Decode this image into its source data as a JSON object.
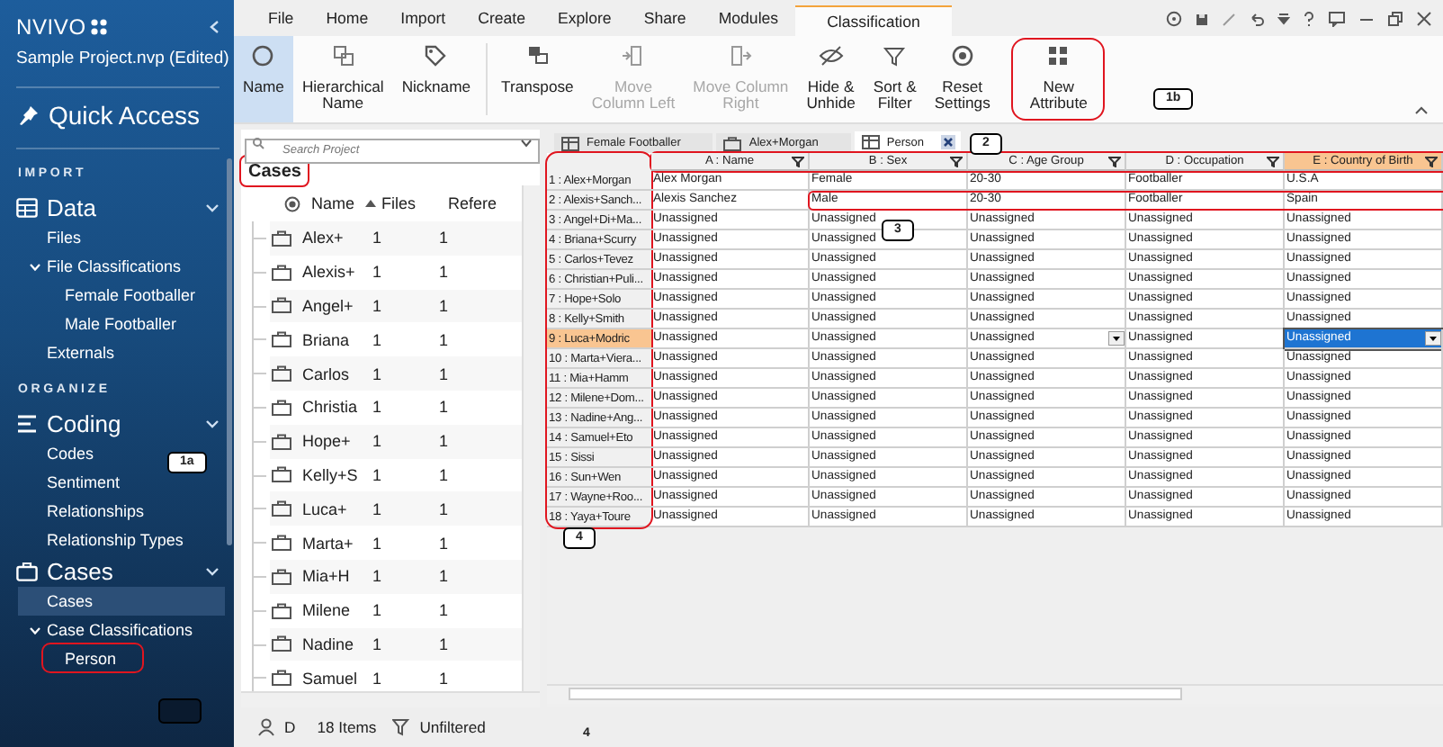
{
  "sidebar": {
    "logo": "NVIVO",
    "project": "Sample Project.nvp (Edited)",
    "quick_access": "Quick Access",
    "sections": [
      {
        "heading": "IMPORT",
        "groups": [
          {
            "title": "Data",
            "expanded": true,
            "items": [
              {
                "label": "Files",
                "selected": false
              },
              {
                "label": "File Classifications",
                "selected": false,
                "expanded": true,
                "children": [
                  {
                    "label": "Female Footballer",
                    "selected": false,
                    "circled": false
                  },
                  {
                    "label": "Male Footballer",
                    "selected": false,
                    "circled": false
                  }
                ]
              },
              {
                "label": "Externals",
                "selected": false
              }
            ]
          }
        ]
      },
      {
        "heading": "ORGANIZE",
        "groups": [
          {
            "title": "Coding",
            "expanded": true,
            "items": [
              {
                "label": "Codes",
                "selected": false
              },
              {
                "label": "Sentiment",
                "selected": false
              },
              {
                "label": "Relationships",
                "selected": false
              },
              {
                "label": "Relationship Types",
                "selected": false
              }
            ]
          },
          {
            "title": "Cases",
            "expanded": true,
            "items": [
              {
                "label": "Cases",
                "selected": true
              },
              {
                "label": "Case Classifications",
                "selected": false,
                "expanded": true,
                "children": [
                  {
                    "label": "Person",
                    "selected": false,
                    "circled": true
                  }
                ]
              }
            ]
          }
        ]
      }
    ]
  },
  "menu": {
    "tabs": [
      {
        "label": "File",
        "selected": false
      },
      {
        "label": "Home",
        "selected": false
      },
      {
        "label": "Import",
        "selected": false
      },
      {
        "label": "Create",
        "selected": false
      },
      {
        "label": "Explore",
        "selected": false
      },
      {
        "label": "Share",
        "selected": false
      },
      {
        "label": "Modules",
        "selected": false
      },
      {
        "label": "Classification",
        "selected": true
      }
    ]
  },
  "ribbon": {
    "buttons": [
      {
        "label": "Name",
        "selected": true,
        "disabled": false,
        "circled": false
      },
      {
        "label": "Hierarchical\nName",
        "selected": false,
        "disabled": false,
        "circled": false
      },
      {
        "label": "Nickname",
        "selected": false,
        "disabled": false,
        "circled": false
      },
      {
        "label": "Transpose",
        "selected": false,
        "disabled": false,
        "circled": false
      },
      {
        "label": "Move\nColumn Left",
        "selected": false,
        "disabled": true,
        "circled": false
      },
      {
        "label": "Move Column\nRight",
        "selected": false,
        "disabled": true,
        "circled": false
      },
      {
        "label": "Hide &\nUnhide",
        "selected": false,
        "disabled": false,
        "circled": false
      },
      {
        "label": "Sort &\nFilter",
        "selected": false,
        "disabled": false,
        "circled": false
      },
      {
        "label": "Reset\nSettings",
        "selected": false,
        "disabled": false,
        "circled": false
      },
      {
        "label": "New\nAttribute",
        "selected": false,
        "disabled": false,
        "circled": true
      }
    ]
  },
  "cases_pane": {
    "search": {
      "placeholder": "Search Project"
    },
    "heading": "Cases",
    "heading_circled": true,
    "columns": [
      "Name",
      "Files",
      "Refere"
    ],
    "rows": [
      {
        "name": "Alex+",
        "files": "1",
        "refs": "1"
      },
      {
        "name": "Alexis+",
        "files": "1",
        "refs": "1"
      },
      {
        "name": "Angel+",
        "files": "1",
        "refs": "1"
      },
      {
        "name": "Briana",
        "files": "1",
        "refs": "1"
      },
      {
        "name": "Carlos",
        "files": "1",
        "refs": "1"
      },
      {
        "name": "Christia",
        "files": "1",
        "refs": "1"
      },
      {
        "name": "Hope+",
        "files": "1",
        "refs": "1"
      },
      {
        "name": "Kelly+S",
        "files": "1",
        "refs": "1"
      },
      {
        "name": "Luca+",
        "files": "1",
        "refs": "1"
      },
      {
        "name": "Marta+",
        "files": "1",
        "refs": "1"
      },
      {
        "name": "Mia+H",
        "files": "1",
        "refs": "1"
      },
      {
        "name": "Milene",
        "files": "1",
        "refs": "1"
      },
      {
        "name": "Nadine",
        "files": "1",
        "refs": "1"
      },
      {
        "name": "Samuel",
        "files": "1",
        "refs": "1"
      }
    ]
  },
  "doc_tabs": [
    {
      "label": "Female Footballer",
      "selected": false,
      "closable": false
    },
    {
      "label": "Alex+Morgan",
      "selected": false,
      "closable": false
    },
    {
      "label": "Person",
      "selected": true,
      "closable": true
    }
  ],
  "grid": {
    "header_circled": true,
    "row_headers_circled": true,
    "columns": [
      {
        "label": "A : Name",
        "selected": false
      },
      {
        "label": "B : Sex",
        "selected": false
      },
      {
        "label": "C : Age Group",
        "selected": false
      },
      {
        "label": "D : Occupation",
        "selected": false
      },
      {
        "label": "E : Country of Birth",
        "selected": true
      }
    ],
    "rows": [
      {
        "header": "1 : Alex+Morgan",
        "selected": false,
        "circled": false,
        "cells": [
          "Alex Morgan",
          "Female",
          "20-30",
          "Footballer",
          "U.S.A"
        ]
      },
      {
        "header": "2 : Alexis+Sanch...",
        "selected": false,
        "circled": true,
        "cells": [
          "Alexis Sanchez",
          "Male",
          "20-30",
          "Footballer",
          "Spain"
        ]
      },
      {
        "header": "3 : Angel+Di+Ma...",
        "selected": false,
        "circled": false,
        "cells": [
          "Unassigned",
          "Unassigned",
          "Unassigned",
          "Unassigned",
          "Unassigned"
        ]
      },
      {
        "header": "4 : Briana+Scurry",
        "selected": false,
        "circled": false,
        "cells": [
          "Unassigned",
          "Unassigned",
          "Unassigned",
          "Unassigned",
          "Unassigned"
        ]
      },
      {
        "header": "5 : Carlos+Tevez",
        "selected": false,
        "circled": false,
        "cells": [
          "Unassigned",
          "Unassigned",
          "Unassigned",
          "Unassigned",
          "Unassigned"
        ]
      },
      {
        "header": "6 : Christian+Puli...",
        "selected": false,
        "circled": false,
        "cells": [
          "Unassigned",
          "Unassigned",
          "Unassigned",
          "Unassigned",
          "Unassigned"
        ]
      },
      {
        "header": "7 : Hope+Solo",
        "selected": false,
        "circled": false,
        "cells": [
          "Unassigned",
          "Unassigned",
          "Unassigned",
          "Unassigned",
          "Unassigned"
        ]
      },
      {
        "header": "8 : Kelly+Smith",
        "selected": false,
        "circled": false,
        "cells": [
          "Unassigned",
          "Unassigned",
          "Unassigned",
          "Unassigned",
          "Unassigned"
        ]
      },
      {
        "header": "9 : Luca+Modric",
        "selected": true,
        "circled": false,
        "cells": [
          "Unassigned",
          "Unassigned",
          "Unassigned",
          "Unassigned",
          "Unassigned"
        ]
      },
      {
        "header": "10 : Marta+Viera...",
        "selected": false,
        "circled": false,
        "cells": [
          "Unassigned",
          "Unassigned",
          "Unassigned",
          "Unassigned",
          "Unassigned"
        ]
      },
      {
        "header": "11 : Mia+Hamm",
        "selected": false,
        "circled": false,
        "cells": [
          "Unassigned",
          "Unassigned",
          "Unassigned",
          "Unassigned",
          "Unassigned"
        ]
      },
      {
        "header": "12 : Milene+Dom...",
        "selected": false,
        "circled": false,
        "cells": [
          "Unassigned",
          "Unassigned",
          "Unassigned",
          "Unassigned",
          "Unassigned"
        ]
      },
      {
        "header": "13 : Nadine+Ang...",
        "selected": false,
        "circled": false,
        "cells": [
          "Unassigned",
          "Unassigned",
          "Unassigned",
          "Unassigned",
          "Unassigned"
        ]
      },
      {
        "header": "14 : Samuel+Eto",
        "selected": false,
        "circled": false,
        "cells": [
          "Unassigned",
          "Unassigned",
          "Unassigned",
          "Unassigned",
          "Unassigned"
        ]
      },
      {
        "header": "15 : Sissi",
        "selected": false,
        "circled": false,
        "cells": [
          "Unassigned",
          "Unassigned",
          "Unassigned",
          "Unassigned",
          "Unassigned"
        ]
      },
      {
        "header": "16 : Sun+Wen",
        "selected": false,
        "circled": false,
        "cells": [
          "Unassigned",
          "Unassigned",
          "Unassigned",
          "Unassigned",
          "Unassigned"
        ]
      },
      {
        "header": "17 : Wayne+Roo...",
        "selected": false,
        "circled": false,
        "cells": [
          "Unassigned",
          "Unassigned",
          "Unassigned",
          "Unassigned",
          "Unassigned"
        ]
      },
      {
        "header": "18 : Yaya+Toure",
        "selected": false,
        "circled": false,
        "cells": [
          "Unassigned",
          "Unassigned",
          "Unassigned",
          "Unassigned",
          "Unassigned"
        ]
      }
    ]
  },
  "status_bar": {
    "user": "D",
    "items": "18 Items",
    "filter": "Unfiltered"
  },
  "annotations": [
    {
      "kind": "label",
      "text": "1a"
    },
    {
      "kind": "label",
      "text": "1b"
    },
    {
      "kind": "label",
      "text": "2"
    },
    {
      "kind": "label",
      "text": "3"
    },
    {
      "kind": "label",
      "text": "4"
    },
    {
      "kind": "plain",
      "text": "4"
    },
    {
      "kind": "empty-box"
    }
  ]
}
